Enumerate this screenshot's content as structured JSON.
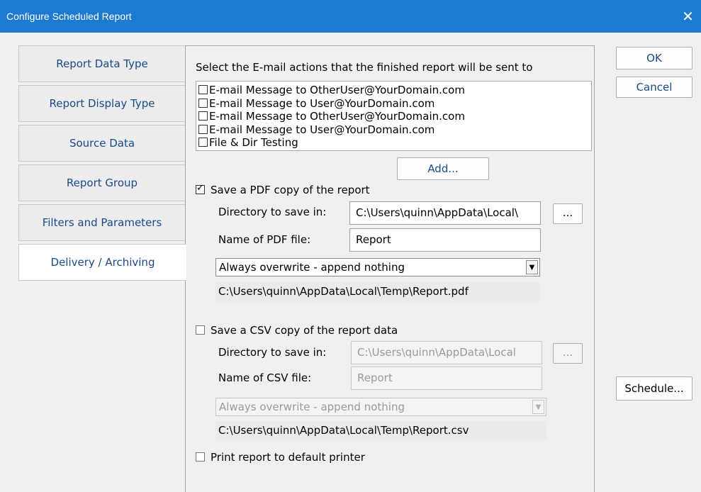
{
  "window": {
    "title": "Configure Scheduled Report",
    "close_glyph": "✕",
    "titlebar_color": "#1e7ad0"
  },
  "tabs": [
    {
      "label": "Report Data Type",
      "active": false
    },
    {
      "label": "Report Display Type",
      "active": false
    },
    {
      "label": "Source Data",
      "active": false
    },
    {
      "label": "Report Group",
      "active": false
    },
    {
      "label": "Filters and Parameters",
      "active": false
    },
    {
      "label": "Delivery / Archiving",
      "active": true
    }
  ],
  "side_buttons": {
    "ok": "OK",
    "cancel": "Cancel",
    "schedule": "Schedule..."
  },
  "email": {
    "heading": "Select the E-mail actions that the finished report will be sent to",
    "items": [
      {
        "label": "E-mail Message to OtherUser@YourDomain.com",
        "checked": false
      },
      {
        "label": "E-mail Message to User@YourDomain.com",
        "checked": false
      },
      {
        "label": "E-mail Message to OtherUser@YourDomain.com",
        "checked": false
      },
      {
        "label": "E-mail Message to User@YourDomain.com",
        "checked": false
      },
      {
        "label": "File & Dir Testing",
        "checked": false
      }
    ],
    "add_button": "Add..."
  },
  "pdf": {
    "checkbox_label": "Save a PDF copy of the report",
    "checked": true,
    "dir_label": "Directory to save in:",
    "dir_value": "C:\\Users\\quinn\\AppData\\Local\\",
    "browse_button": "...",
    "name_label": "Name of PDF file:",
    "name_value": "Report",
    "overwrite_option": "Always overwrite - append nothing",
    "full_path": "C:\\Users\\quinn\\AppData\\Local\\Temp\\Report.pdf"
  },
  "csv": {
    "checkbox_label": "Save a CSV copy of the report data",
    "checked": false,
    "dir_label": "Directory to save in:",
    "dir_value": "C:\\Users\\quinn\\AppData\\Local",
    "browse_button": "...",
    "name_label": "Name of CSV file:",
    "name_value": "Report",
    "overwrite_option": "Always overwrite - append nothing",
    "full_path": "C:\\Users\\quinn\\AppData\\Local\\Temp\\Report.csv"
  },
  "print": {
    "checkbox_label": "Print report to default printer",
    "checked": false
  }
}
